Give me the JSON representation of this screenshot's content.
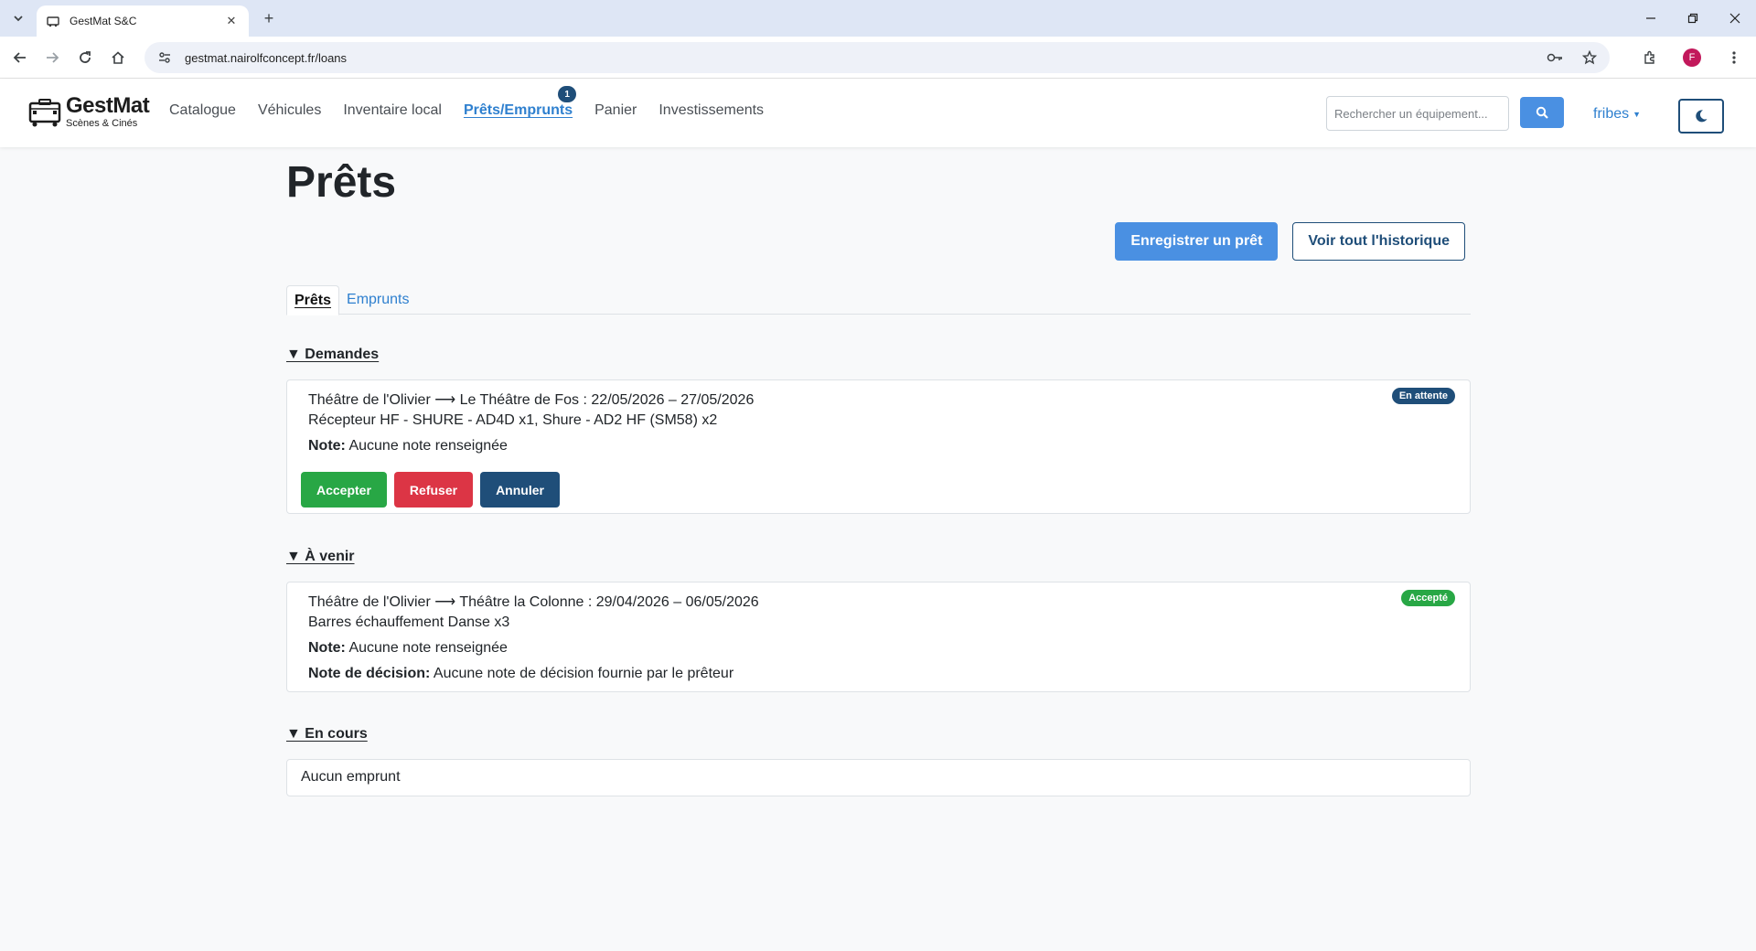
{
  "browser": {
    "tab_title": "GestMat S&C",
    "url": "gestmat.nairolfconcept.fr/loans",
    "profile_initial": "F"
  },
  "app": {
    "brand_name": "GestMat",
    "brand_sub": "Scènes & Cinés",
    "nav": [
      {
        "label": "Catalogue",
        "active": false
      },
      {
        "label": "Véhicules",
        "active": false
      },
      {
        "label": "Inventaire local",
        "active": false
      },
      {
        "label": "Prêts/Emprunts",
        "active": true,
        "badge": "1"
      },
      {
        "label": "Panier",
        "active": false
      },
      {
        "label": "Investissements",
        "active": false
      }
    ],
    "search_placeholder": "Rechercher un équipement...",
    "user": "fribes"
  },
  "page": {
    "title": "Prêts",
    "register_btn": "Enregistrer un prêt",
    "history_btn": "Voir tout l'historique",
    "tabs": [
      {
        "label": "Prêts",
        "active": true
      },
      {
        "label": "Emprunts",
        "active": false
      }
    ]
  },
  "sections": {
    "demandes": {
      "title": "▼ Demandes",
      "route": "Théâtre de l'Olivier ⟶ Le Théâtre de Fos : 22/05/2026 – 27/05/2026",
      "items": "Récepteur HF - SHURE - AD4D x1, Shure - AD2 HF (SM58) x2",
      "note_label": "Note:",
      "note_value": "Aucune note renseignée",
      "status": "En attente",
      "accept_btn": "Accepter",
      "refuse_btn": "Refuser",
      "cancel_btn": "Annuler"
    },
    "a_venir": {
      "title": "▼ À venir",
      "route": "Théâtre de l'Olivier ⟶ Théâtre la Colonne : 29/04/2026 – 06/05/2026",
      "items": "Barres échauffement Danse x3",
      "note_label": "Note:",
      "note_value": "Aucune note renseignée",
      "decision_label": "Note de décision:",
      "decision_value": "Aucune note de décision fournie par le prêteur",
      "status": "Accepté"
    },
    "en_cours": {
      "title": "▼ En cours",
      "empty": "Aucun emprunt"
    }
  },
  "colors": {
    "primary": "#4a90e2",
    "navy": "#1f4e79",
    "success": "#28a745",
    "danger": "#dc3545"
  }
}
